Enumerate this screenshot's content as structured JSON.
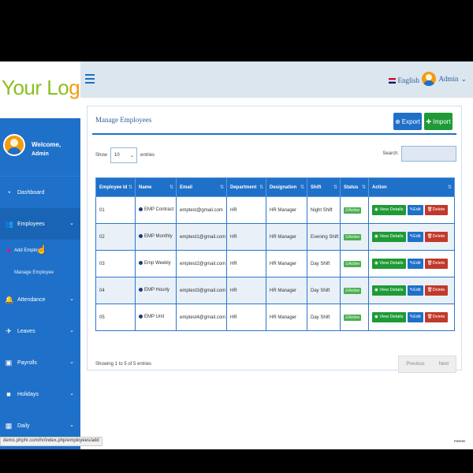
{
  "logo": {
    "part1": "Your Lo",
    "part2": "go"
  },
  "header": {
    "language": "English",
    "user": "Admin"
  },
  "sidebar": {
    "welcome": "Welcome,",
    "name": "Admin",
    "items": [
      {
        "label": "Dashboard",
        "icon": "dashboard-icon"
      },
      {
        "label": "Employees",
        "icon": "users-icon"
      },
      {
        "label": "Attendance",
        "icon": "bell-icon"
      },
      {
        "label": "Leaves",
        "icon": "plane-icon"
      },
      {
        "label": "Payrolls",
        "icon": "payroll-icon"
      },
      {
        "label": "Holidays",
        "icon": "briefcase-icon"
      },
      {
        "label": "Daily",
        "icon": "calendar-icon"
      }
    ],
    "sub_items": [
      {
        "label": "Add Employ"
      },
      {
        "label": "Manage Employee"
      }
    ]
  },
  "card": {
    "title": "Manage Employees",
    "export_label": "Export",
    "import_label": "Import",
    "show_label": "Show",
    "entries_value": "10",
    "entries_label": "entries",
    "search_label": "Search:"
  },
  "table": {
    "headers": [
      "Employee Id",
      "Name",
      "Email",
      "Department",
      "Designation",
      "Shift",
      "Status",
      "Action"
    ],
    "rows": [
      {
        "id": "01",
        "name": "EMP Contract",
        "email": "emptest@gmail.com",
        "department": "HR",
        "designation": "HR Manager",
        "shift": "Night Shift",
        "status": "Active"
      },
      {
        "id": "02",
        "name": "EMP Monthly",
        "email": "emptest1@gmail.com",
        "department": "HR",
        "designation": "HR Manager",
        "shift": "Evening Shift",
        "status": "Active"
      },
      {
        "id": "03",
        "name": "Emp Weekly",
        "email": "emptest2@gmail.com",
        "department": "HR",
        "designation": "HR Manager",
        "shift": "Day Shift",
        "status": "Active"
      },
      {
        "id": "04",
        "name": "EMP Hourly",
        "email": "emptest3@gmail.com",
        "department": "HR",
        "designation": "HR Manager",
        "shift": "Day Shift",
        "status": "Active"
      },
      {
        "id": "05",
        "name": "EMP Unit",
        "email": "emptest4@gmail.com",
        "department": "HR",
        "designation": "HR Manager",
        "shift": "Day Shift",
        "status": "Active"
      }
    ],
    "actions": {
      "view": "View Details",
      "edit": "Edit",
      "delete": "Delete"
    }
  },
  "footer": {
    "info": "Showing 1 to 5 of 5 entries",
    "previous": "Previous",
    "next": "Next"
  },
  "statusbar": {
    "url": "demo.phphr.com/hr/index.php/employees/add"
  },
  "colors": {
    "primary": "#1f70c8",
    "success": "#1e9a36",
    "danger": "#c0392b",
    "logo_green": "#8bbf22",
    "logo_orange": "#f39c12"
  }
}
